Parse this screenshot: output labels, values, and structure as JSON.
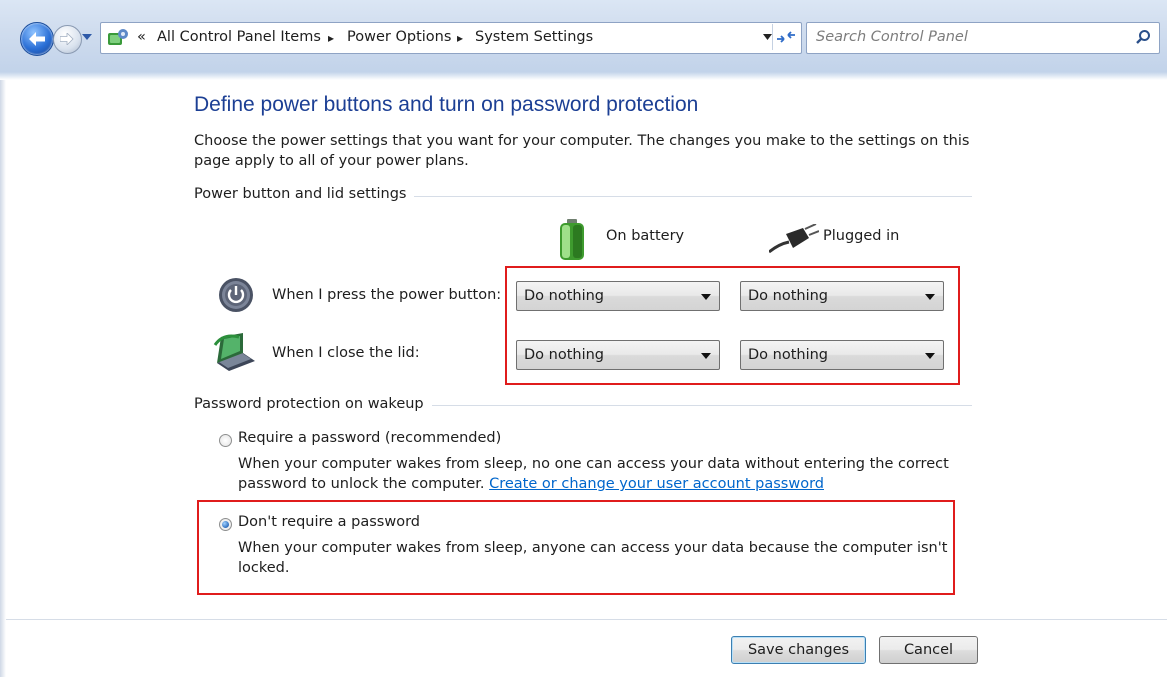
{
  "address_bar": {
    "breadcrumbs": {
      "overflow": "«",
      "items": [
        "All Control Panel Items",
        "Power Options",
        "System Settings"
      ],
      "separator": "▸"
    },
    "search_placeholder": "Search Control Panel"
  },
  "page": {
    "title": "Define power buttons and turn on password protection",
    "intro": "Choose the power settings that you want for your computer. The changes you make to the settings on this page apply to all of your power plans."
  },
  "power_section": {
    "label": "Power button and lid settings",
    "columns": {
      "battery": "On battery",
      "plugged": "Plugged in"
    },
    "rows": [
      {
        "label": "When I press the power button:",
        "battery": "Do nothing",
        "plugged": "Do nothing",
        "icon": "power-button-icon"
      },
      {
        "label": "When I close the lid:",
        "battery": "Do nothing",
        "plugged": "Do nothing",
        "icon": "laptop-lid-icon"
      }
    ]
  },
  "password_section": {
    "label": "Password protection on wakeup",
    "options": [
      {
        "label": "Require a password (recommended)",
        "desc": "When your computer wakes from sleep, no one can access your data without entering the correct password to unlock the computer.",
        "link": "Create or change your user account password",
        "selected": false
      },
      {
        "label": "Don't require a password",
        "desc": "When your computer wakes from sleep, anyone can access your data because the computer isn't locked.",
        "selected": true
      }
    ]
  },
  "buttons": {
    "save": "Save changes",
    "cancel": "Cancel"
  },
  "colors": {
    "title": "#1c3f94",
    "link": "#0066cc",
    "highlight": "#e01c1c"
  }
}
